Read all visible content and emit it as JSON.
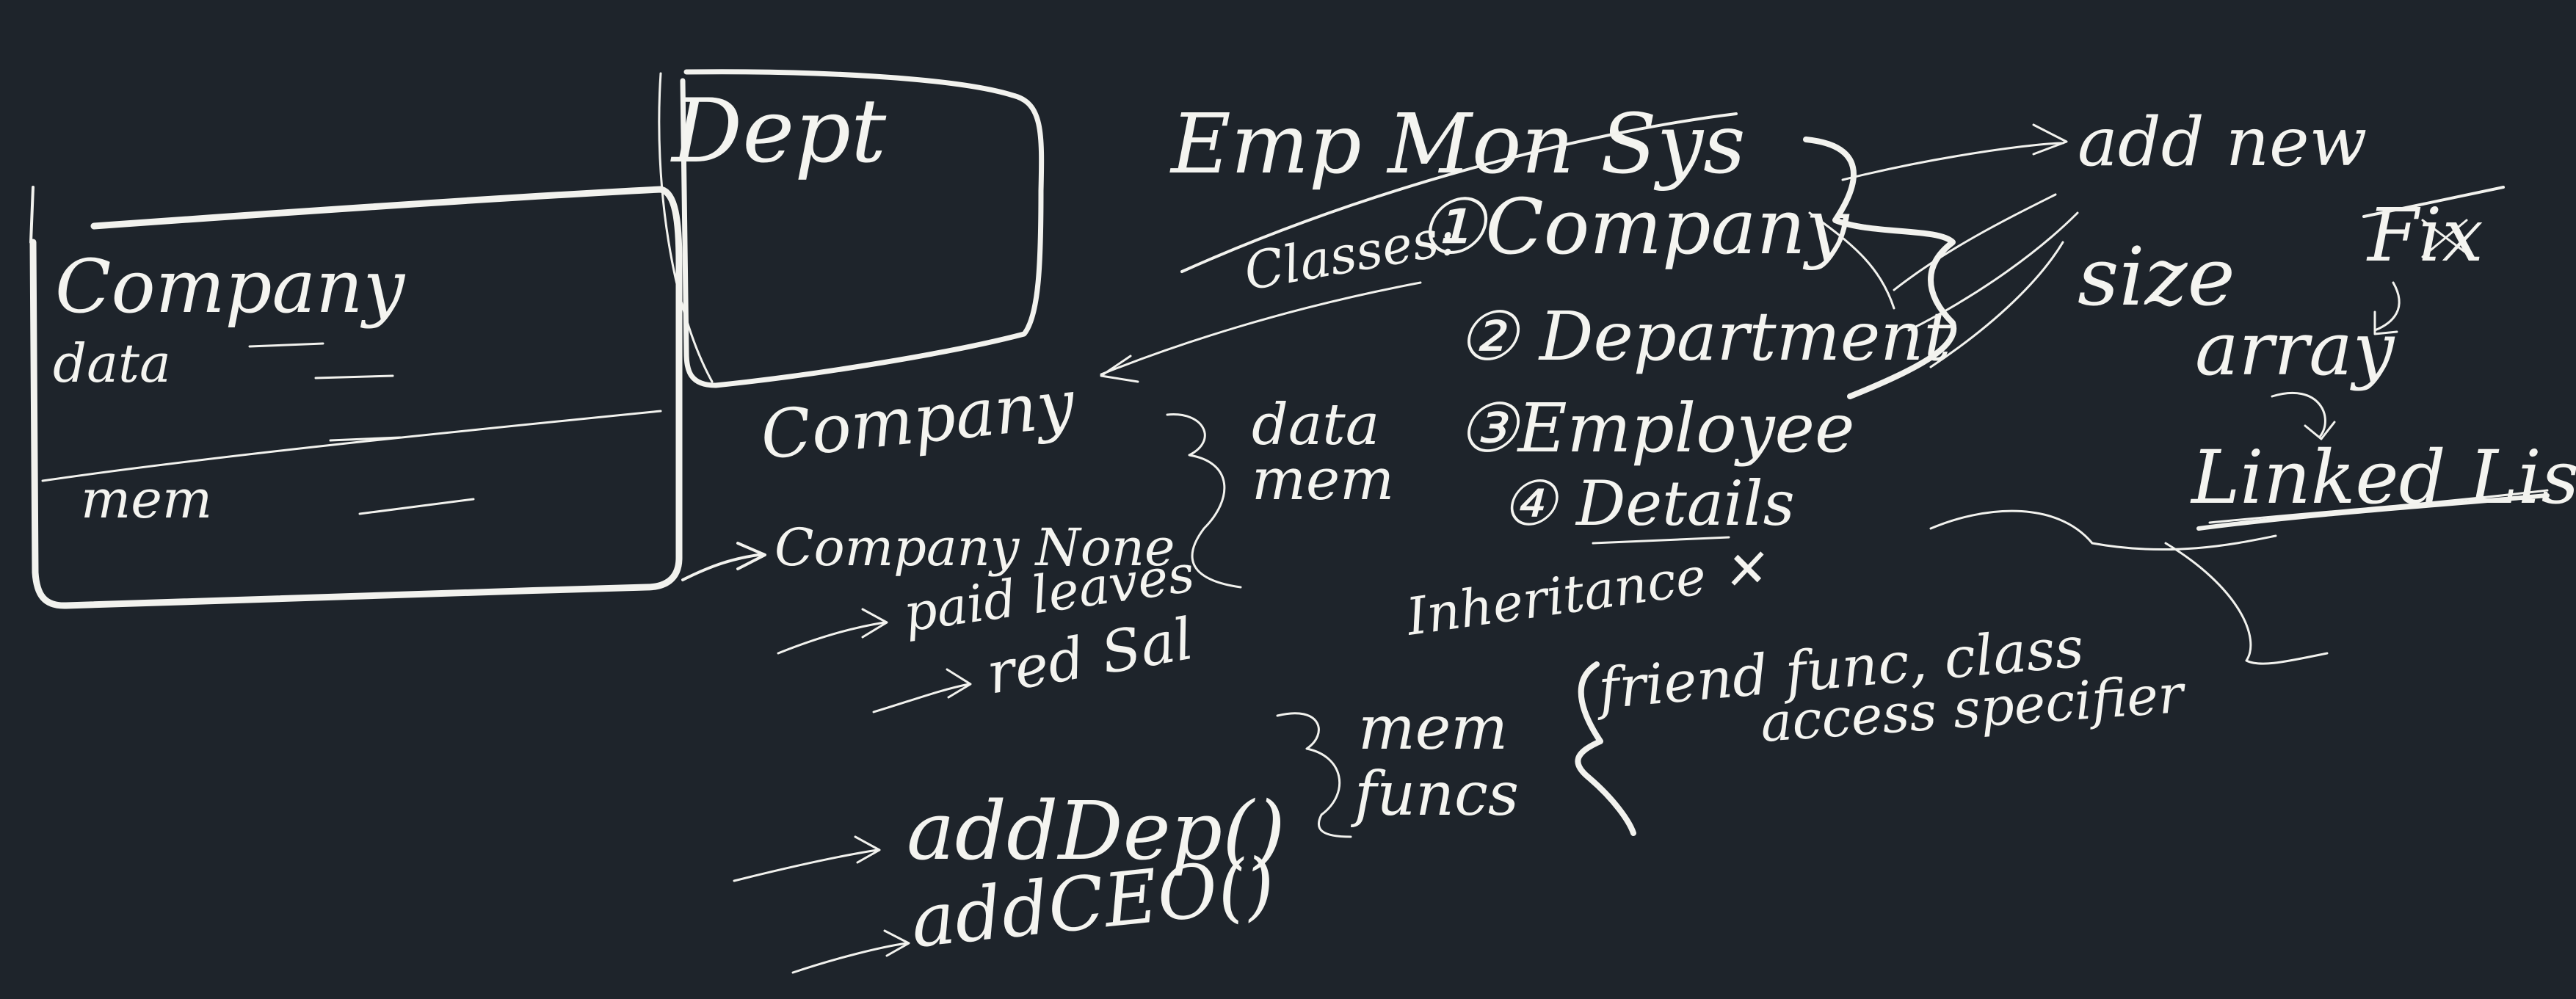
{
  "board": {
    "background_color": "#1e242b",
    "ink_color": "#f2f2ee",
    "title": "Emp Mon Sys",
    "company_box": {
      "title": "Company",
      "row1": "data",
      "row2": "mem"
    },
    "dept_box": {
      "title": "Dept"
    },
    "classes": {
      "label": "Classes:",
      "items": [
        "①Company",
        "② Department",
        "③Employee",
        "④ Details"
      ]
    },
    "add_new": "add new",
    "size_label": "size",
    "fix_label": "Fix",
    "array_label": "array",
    "linked_list_label": "Linked List",
    "company_column": [
      "Company",
      "Company None",
      "paid leaves",
      "red Sal"
    ],
    "data_mem_label": [
      "data",
      "mem"
    ],
    "inheritance_label": "Inheritance ✕",
    "friend_label": "friend func, class",
    "access_label": "access specifier",
    "functions": [
      "addDep()",
      "addCEO()"
    ],
    "mem_funcs_label": [
      "mem",
      "funcs"
    ]
  }
}
